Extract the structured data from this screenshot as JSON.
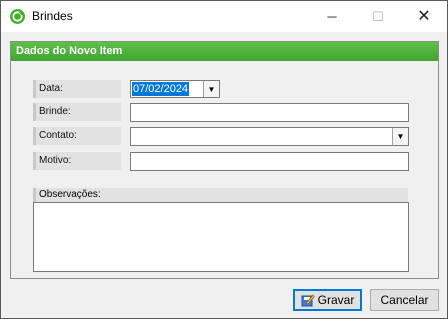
{
  "window": {
    "title": "Brindes",
    "minimize_glyph": "─",
    "maximize_glyph": "☐",
    "close_glyph": "✕"
  },
  "group": {
    "title": "Dados do Novo Item"
  },
  "form": {
    "data": {
      "label": "Data:",
      "value": "07/02/2024"
    },
    "brinde": {
      "label": "Brinde:",
      "value": ""
    },
    "contato": {
      "label": "Contato:",
      "value": ""
    },
    "motivo": {
      "label": "Motivo:",
      "value": ""
    },
    "observacoes": {
      "label": "Observações:",
      "value": ""
    }
  },
  "buttons": {
    "gravar": "Gravar",
    "cancelar": "Cancelar"
  },
  "icons": {
    "app": "green-check-circle-icon",
    "dropdown": "chevron-down-icon",
    "save": "save-pencil-icon"
  },
  "colors": {
    "header_green": "#4cb33a",
    "selection_blue": "#0078d7"
  }
}
